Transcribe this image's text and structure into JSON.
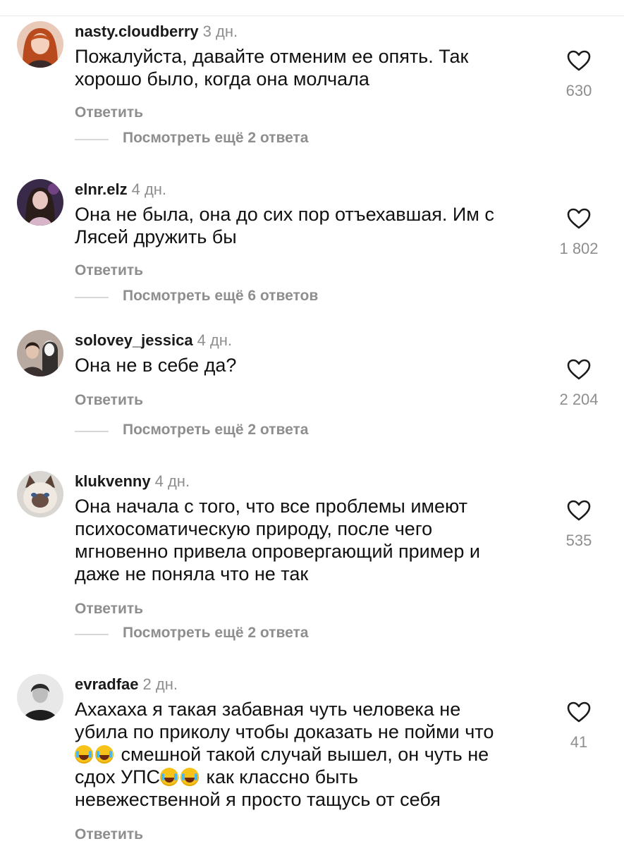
{
  "comments": [
    {
      "username": "nasty.cloudberry",
      "time": "3 дн.",
      "lines": [
        "Пожалуйста, давайте отменим ее опять. Так",
        "хорошо было, когда она молчала"
      ],
      "reply_label": "Ответить",
      "more_replies": "Посмотреть ещё 2 ответа",
      "likes": "630",
      "avatar_icon": "avatar-girl-orange-hair"
    },
    {
      "username": "elnr.elz",
      "time": "4 дн.",
      "lines": [
        "Она не была, она до сих пор отъехавшая. Им с",
        "Лясей дружить бы"
      ],
      "reply_label": "Ответить",
      "more_replies": "Посмотреть ещё 6 ответов",
      "likes": "1 802",
      "avatar_icon": "avatar-woman-purple"
    },
    {
      "username": "solovey_jessica",
      "time": "4 дн.",
      "lines": [
        "Она не в себе да?"
      ],
      "reply_label": "Ответить",
      "more_replies": "Посмотреть ещё 2 ответа",
      "likes": "2 204",
      "avatar_icon": "avatar-group-photo"
    },
    {
      "username": "klukvenny",
      "time": "4 дн.",
      "lines": [
        "Она начала с того, что все проблемы имеют",
        "психосоматическую природу, после чего",
        "мгновенно привела опровергающий пример и",
        "даже не поняла что не так"
      ],
      "reply_label": "Ответить",
      "more_replies": "Посмотреть ещё 2 ответа",
      "likes": "535",
      "avatar_icon": "avatar-cat"
    },
    {
      "username": "evradfae",
      "time": "2 дн.",
      "lines": [
        "Ахахаха я такая забавная чуть человека не",
        "убила по приколу чтобы доказать не пойми что",
        "смешной такой случай вышел, он чуть не",
        "сдох УПС",
        "как классно быть",
        "невежественной я просто тащусь от себя"
      ],
      "reply_label": "Ответить",
      "likes": "41",
      "avatar_icon": "avatar-monochrome-person",
      "emoji_icon": "face-with-tears-of-joy-icon"
    }
  ],
  "icons": {
    "like": "heart-outline-icon"
  },
  "colors": {
    "secondary_text": "#8e8e8e",
    "primary_text": "#111111",
    "background": "#ffffff"
  }
}
